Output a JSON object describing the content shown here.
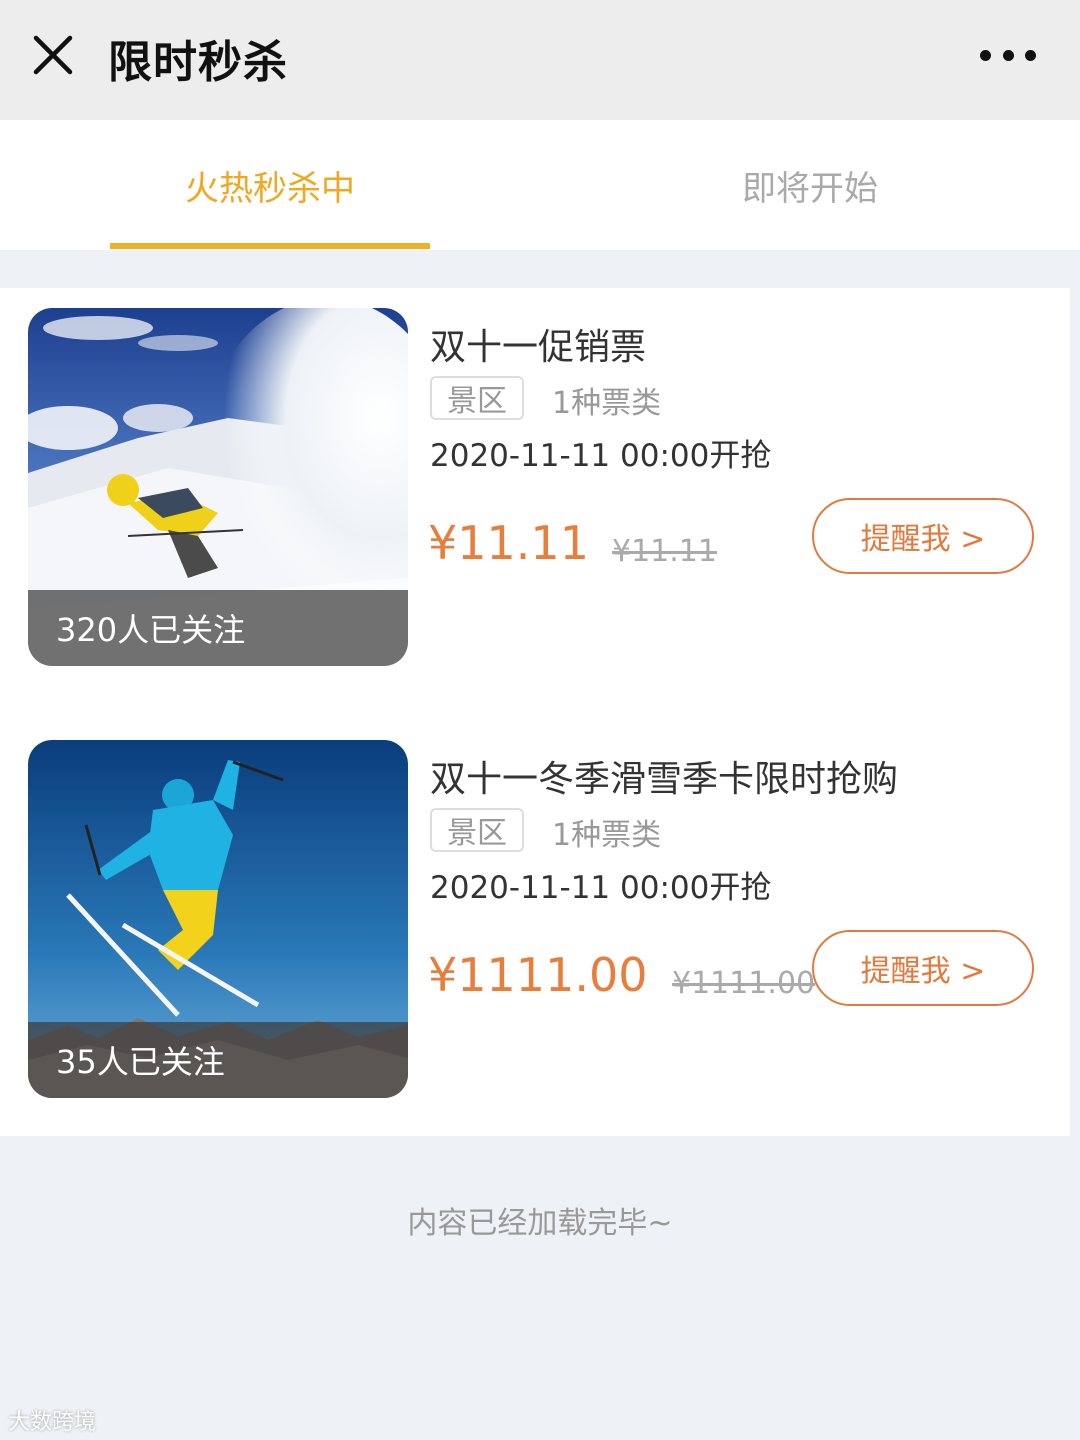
{
  "header": {
    "title": "限时秒杀",
    "close_icon": "close-icon",
    "more_icon": "more-dots-icon"
  },
  "tabs": [
    {
      "label": "火热秒杀中",
      "active": true
    },
    {
      "label": "即将开始",
      "active": false
    }
  ],
  "items": [
    {
      "title": "双十一促销票",
      "tag": "景区",
      "ticket_types": "1种票类",
      "start_time": "2020-11-11 00:00开抢",
      "price": "¥11.11",
      "original_price": "¥11.11",
      "followers": "320人已关注",
      "button_label": "提醒我 >",
      "image": "skier-powder-snow"
    },
    {
      "title": "双十一冬季滑雪季卡限时抢购",
      "tag": "景区",
      "ticket_types": "1种票类",
      "start_time": "2020-11-11 00:00开抢",
      "price": "¥1111.00",
      "original_price": "¥1111.00",
      "followers": "35人已关注",
      "button_label": "提醒我 >",
      "image": "skier-jump-blue-sky"
    }
  ],
  "footer": {
    "end_text": "内容已经加载完毕~"
  },
  "watermark": "大数跨境",
  "colors": {
    "accent": "#f0a81f",
    "price": "#e87e3c",
    "button_border": "#e27a3f"
  }
}
